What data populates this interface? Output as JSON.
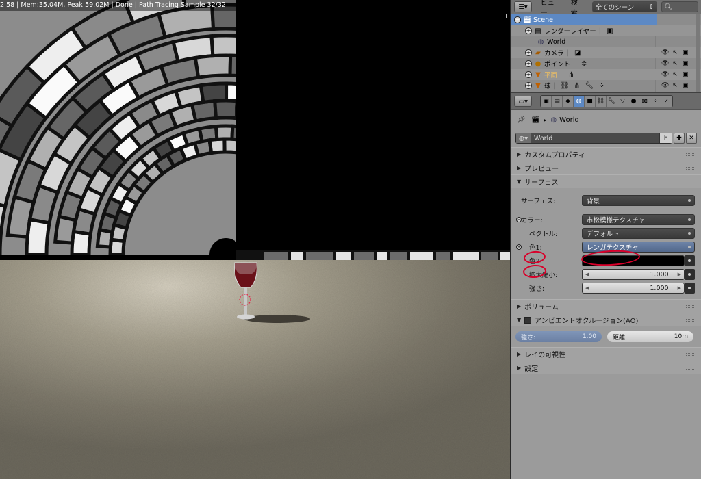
{
  "viewport": {
    "status_text": "2.58 | Mem:35.04M, Peak:59.02M | Done | Path Tracing Sample 32/32",
    "plus_glyph": "+"
  },
  "outliner_header": {
    "editor_icon": "outliner-icon",
    "view_menu": "ビュー",
    "search_menu": "検索",
    "scene_filter": "全てのシーン",
    "search_placeholder": ""
  },
  "outliner": {
    "rows": [
      {
        "label": "Scene",
        "icon": "scene-icon"
      },
      {
        "label": "レンダーレイヤー",
        "icon": "render-layers-icon"
      },
      {
        "label": "World",
        "icon": "world-icon"
      },
      {
        "label": "カメラ",
        "icon": "camera-icon"
      },
      {
        "label": "ポイント",
        "icon": "lamp-icon"
      },
      {
        "label": "平面",
        "icon": "mesh-icon"
      },
      {
        "label": "球",
        "icon": "mesh-icon"
      }
    ]
  },
  "properties": {
    "breadcrumb_world": "World",
    "world_name": "World",
    "fake_user": "F",
    "panels": {
      "custom_props": "カスタムプロパティ",
      "preview": "プレビュー",
      "surface": "サーフェス",
      "volume": "ボリューム",
      "ao": "アンビエントオクルージョン(AO)",
      "ray_visibility": "レイの可視性",
      "settings": "設定"
    },
    "surface": {
      "surface_label": "サーフェス:",
      "surface_value": "背景",
      "color_label": "カラー:",
      "color_value": "市松模様テクスチャ",
      "vector_label": "ベクトル:",
      "vector_value": "デフォルト",
      "color1_label": "色1:",
      "color1_value": "レンガテクスチャ",
      "color2_label": "色2:",
      "scale_label": "拡大縮小:",
      "scale_value": "1.000",
      "strength_label": "強さ:",
      "strength_value": "1.000"
    },
    "ao": {
      "strength_label": "強さ:",
      "strength_value": "1.00",
      "distance_label": "距離:",
      "distance_value": "10m"
    }
  },
  "colors": {
    "active_blue": "#5d89c4",
    "panel_bg": "#9b9b9b",
    "annotation_red": "#d8002a"
  }
}
